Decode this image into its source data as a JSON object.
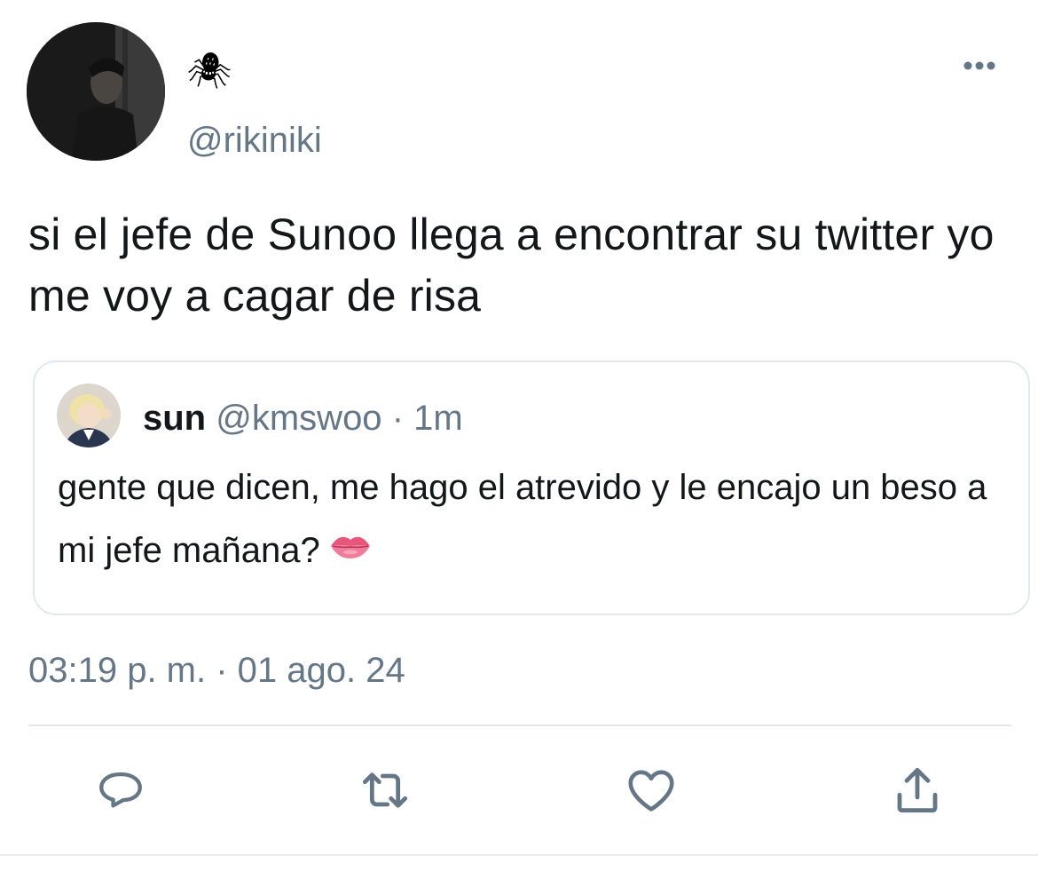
{
  "tweet": {
    "display_name": "🕷",
    "handle": "@rikiniki",
    "text": "si el jefe de Sunoo llega a encontrar su twitter yo me voy a cagar de risa",
    "timestamp": "03:19 p. m. · 01 ago. 24"
  },
  "quoted_tweet": {
    "name": "sun",
    "handle": "@kmswoo",
    "separator": "·",
    "time": "1m",
    "text": "gente que dicen, me hago el atrevido y le encajo un beso a mi jefe mañana?",
    "emoji": "lips-emoji"
  },
  "icons": {
    "more": "more-options-icon",
    "reply": "reply-icon",
    "retweet": "retweet-icon",
    "like": "like-icon",
    "share": "share-icon"
  },
  "colors": {
    "text_primary": "#14171a",
    "text_secondary": "#657786",
    "border": "#e1e8ed",
    "icon": "#657786"
  }
}
